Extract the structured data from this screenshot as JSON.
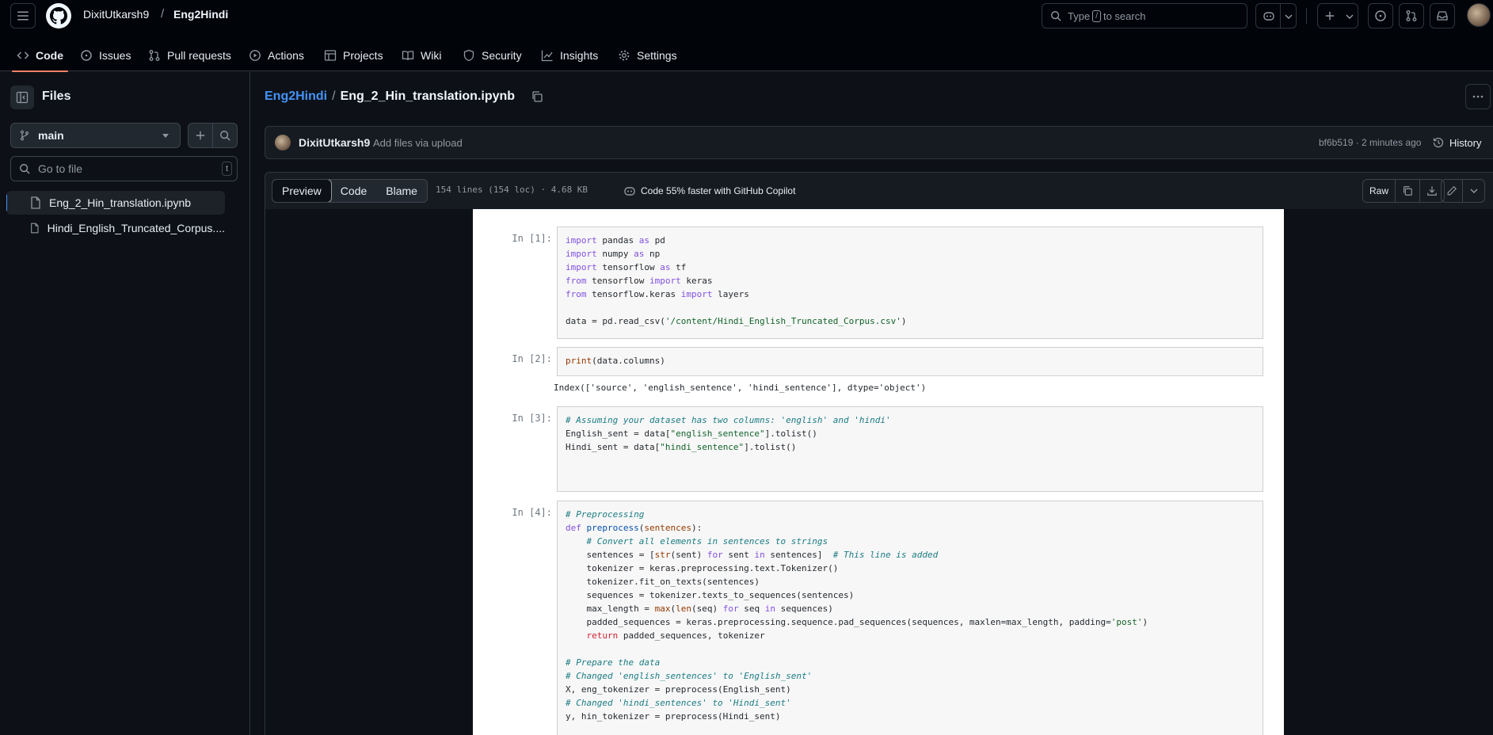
{
  "header": {
    "owner": "DixitUtkarsh9",
    "separator": "/",
    "repo": "Eng2Hindi",
    "search_before": "Type",
    "search_key": "/",
    "search_after": "to search"
  },
  "repo_tabs": [
    {
      "label": "Code",
      "icon": "code-icon"
    },
    {
      "label": "Issues",
      "icon": "issue-icon"
    },
    {
      "label": "Pull requests",
      "icon": "pull-request-icon"
    },
    {
      "label": "Actions",
      "icon": "play-icon"
    },
    {
      "label": "Projects",
      "icon": "table-icon"
    },
    {
      "label": "Wiki",
      "icon": "book-icon"
    },
    {
      "label": "Security",
      "icon": "shield-icon"
    },
    {
      "label": "Insights",
      "icon": "graph-icon"
    },
    {
      "label": "Settings",
      "icon": "gear-icon"
    }
  ],
  "sidebar": {
    "title": "Files",
    "branch": "main",
    "goto_placeholder": "Go to file",
    "goto_key": "t",
    "files": [
      {
        "name": "Eng_2_Hin_translation.ipynb",
        "active": true
      },
      {
        "name": "Hindi_English_Truncated_Corpus...."
      }
    ]
  },
  "path": {
    "repo": "Eng2Hindi",
    "separator": "/",
    "file": "Eng_2_Hin_translation.ipynb"
  },
  "commit": {
    "user": "DixitUtkarsh9",
    "message": "Add files via upload",
    "sha_time": "bf6b519 · 2 minutes ago",
    "history": "History"
  },
  "file_toolbar": {
    "views": [
      "Preview",
      "Code",
      "Blame"
    ],
    "active_view": "Preview",
    "meta": "154 lines (154 loc) · 4.68 KB",
    "copilot": "Code 55% faster with GitHub Copilot",
    "raw": "Raw"
  },
  "notebook": {
    "cells": [
      {
        "prompt": "In [1]:",
        "lines": [
          [
            [
              "kw",
              "import"
            ],
            [
              "t",
              " pandas "
            ],
            [
              "kw",
              "as"
            ],
            [
              "t",
              " pd"
            ]
          ],
          [
            [
              "kw",
              "import"
            ],
            [
              "t",
              " numpy "
            ],
            [
              "kw",
              "as"
            ],
            [
              "t",
              " np"
            ]
          ],
          [
            [
              "kw",
              "import"
            ],
            [
              "t",
              " tensorflow "
            ],
            [
              "kw",
              "as"
            ],
            [
              "t",
              " tf"
            ]
          ],
          [
            [
              "kw",
              "from"
            ],
            [
              "t",
              " tensorflow "
            ],
            [
              "kw",
              "import"
            ],
            [
              "t",
              " keras"
            ]
          ],
          [
            [
              "kw",
              "from"
            ],
            [
              "t",
              " tensorflow.keras "
            ],
            [
              "kw",
              "import"
            ],
            [
              "t",
              " layers"
            ]
          ],
          [],
          [
            [
              "t",
              "data = pd.read_csv("
            ],
            [
              "str",
              "'/content/Hindi_English_Truncated_Corpus.csv'"
            ],
            [
              "t",
              ")"
            ]
          ]
        ]
      },
      {
        "prompt": "In [2]:",
        "lines": [
          [
            [
              "bk",
              "print"
            ],
            [
              "t",
              "(data.columns)"
            ]
          ]
        ],
        "output": "Index(['source', 'english_sentence', 'hindi_sentence'], dtype='object')"
      },
      {
        "prompt": "In [3]:",
        "lines": [
          [
            [
              "cm",
              "# Assuming your dataset has two columns: 'english' and 'hindi'"
            ]
          ],
          [
            [
              "t",
              "English_sent = data["
            ],
            [
              "str",
              "\"english_sentence\""
            ],
            [
              "t",
              "].tolist()"
            ]
          ],
          [
            [
              "t",
              "Hindi_sent = data["
            ],
            [
              "str",
              "\"hindi_sentence\""
            ],
            [
              "t",
              "].tolist()"
            ]
          ]
        ]
      },
      {
        "prompt": "In [4]:",
        "lines": [
          [
            [
              "cm",
              "# Preprocessing"
            ]
          ],
          [
            [
              "kw",
              "def"
            ],
            [
              "t",
              " "
            ],
            [
              "fn",
              "preprocess"
            ],
            [
              "t",
              "("
            ],
            [
              "bk",
              "sentences"
            ],
            [
              "t",
              "):"
            ]
          ],
          [
            [
              "t",
              "    "
            ],
            [
              "cm",
              "# Convert all elements in sentences to strings"
            ]
          ],
          [
            [
              "t",
              "    sentences = ["
            ],
            [
              "bk",
              "str"
            ],
            [
              "t",
              "(sent) "
            ],
            [
              "kw",
              "for"
            ],
            [
              "t",
              " sent "
            ],
            [
              "kw",
              "in"
            ],
            [
              "t",
              " sentences]  "
            ],
            [
              "cm",
              "# This line is added"
            ]
          ],
          [
            [
              "t",
              "    tokenizer = keras.preprocessing.text.Tokenizer()"
            ]
          ],
          [
            [
              "t",
              "    tokenizer.fit_on_texts(sentences)"
            ]
          ],
          [
            [
              "t",
              "    sequences = tokenizer.texts_to_sequences(sentences)"
            ]
          ],
          [
            [
              "t",
              "    max_length = "
            ],
            [
              "bk",
              "max"
            ],
            [
              "t",
              "("
            ],
            [
              "bk",
              "len"
            ],
            [
              "t",
              "(seq) "
            ],
            [
              "kw",
              "for"
            ],
            [
              "t",
              " seq "
            ],
            [
              "kw",
              "in"
            ],
            [
              "t",
              " sequences)"
            ]
          ],
          [
            [
              "t",
              "    padded_sequences = keras.preprocessing.sequence.pad_sequences(sequences, maxlen=max_length, padding="
            ],
            [
              "str",
              "'post'"
            ],
            [
              "t",
              ")"
            ]
          ],
          [
            [
              "t",
              "    "
            ],
            [
              "pkw",
              "return"
            ],
            [
              "t",
              " padded_sequences, tokenizer"
            ]
          ],
          [],
          [
            [
              "cm",
              "# Prepare the data"
            ]
          ],
          [
            [
              "cm",
              "# Changed 'english_sentences' to 'English_sent'"
            ]
          ],
          [
            [
              "t",
              "X, eng_tokenizer = preprocess(English_sent)"
            ]
          ],
          [
            [
              "cm",
              "# Changed 'hindi_sentences' to 'Hindi_sent'"
            ]
          ],
          [
            [
              "t",
              "y, hin_tokenizer = preprocess(Hindi_sent)"
            ]
          ]
        ]
      }
    ]
  }
}
